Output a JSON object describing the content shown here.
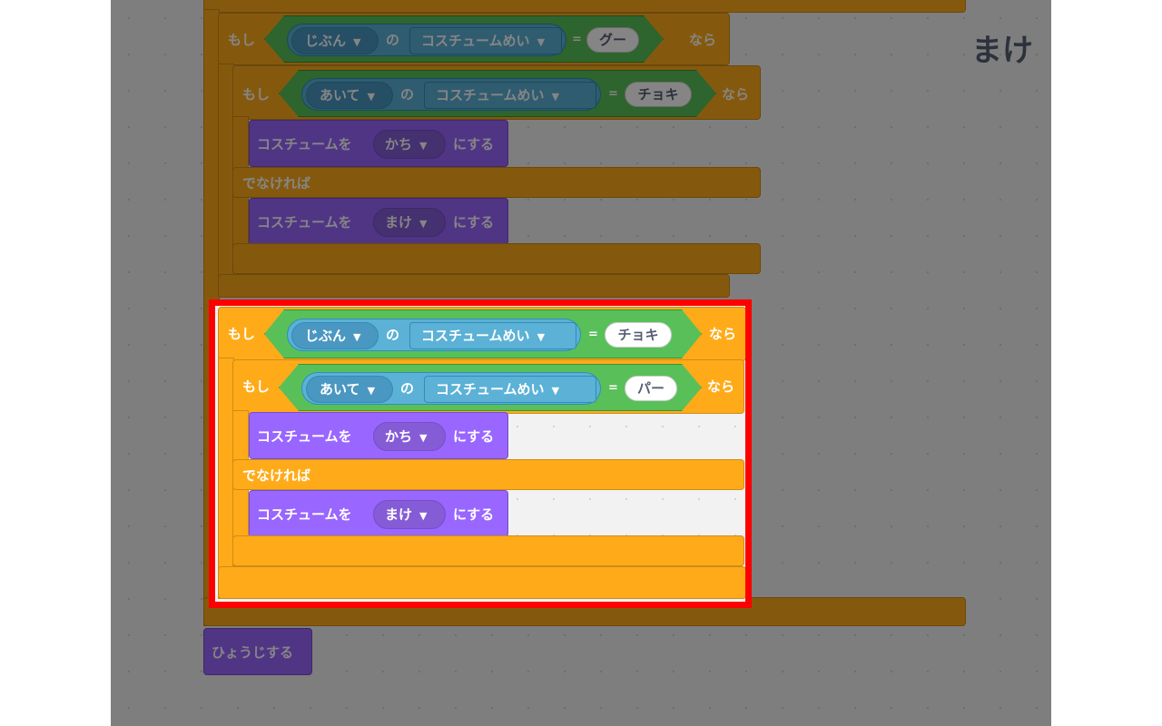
{
  "keywords": {
    "if": "もし",
    "then": "なら",
    "else": "でなければ",
    "of": "の",
    "equals": "="
  },
  "sensing": {
    "self_sprite": "じぶん",
    "opponent_sprite": "あいて",
    "attribute": "コスチュームめい"
  },
  "values": {
    "rock": "グー",
    "scissors": "チョキ",
    "paper": "パー"
  },
  "looks": {
    "switch_costume_prefix": "コスチュームを",
    "switch_costume_suffix": "にする",
    "costume_win": "かち",
    "costume_lose": "まけ",
    "show": "ひょうじする"
  },
  "stage": {
    "sprite_costume_label": "まけ"
  },
  "colors": {
    "control": "#ffab19",
    "looks": "#9966ff",
    "operators": "#59c059",
    "sensing": "#5cb1d6",
    "highlight": "#ff0000"
  }
}
